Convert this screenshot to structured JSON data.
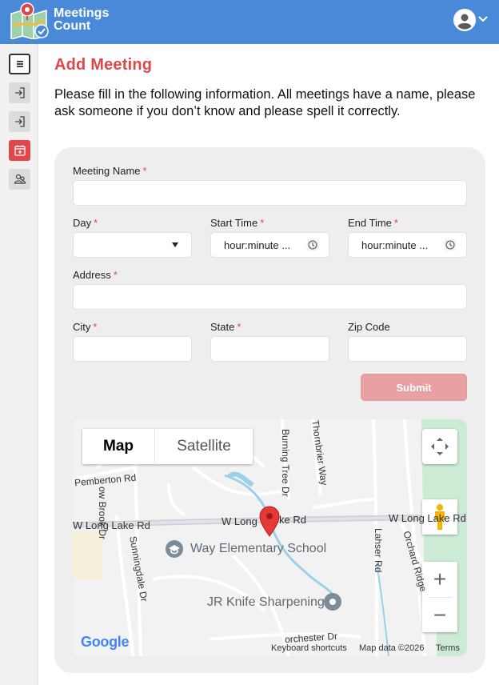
{
  "brand": {
    "line1": "Meetings",
    "line2": "Count"
  },
  "sidebar": {
    "items": [
      {
        "name": "menu"
      },
      {
        "name": "sign-in"
      },
      {
        "name": "sign-in-2"
      },
      {
        "name": "add-meeting"
      },
      {
        "name": "users"
      }
    ]
  },
  "page": {
    "title": "Add Meeting",
    "intro": "Please fill in the following information. All meetings have a name, please ask someone if you don’t know and please spell it correctly."
  },
  "form": {
    "required_mark": "*",
    "meeting_name": {
      "label": "Meeting Name",
      "value": ""
    },
    "day": {
      "label": "Day",
      "value": ""
    },
    "start_time": {
      "label": "Start Time",
      "placeholder": "hour:minute ..."
    },
    "end_time": {
      "label": "End Time",
      "placeholder": "hour:minute ..."
    },
    "address": {
      "label": "Address",
      "value": ""
    },
    "city": {
      "label": "City",
      "value": ""
    },
    "state": {
      "label": "State",
      "value": ""
    },
    "zip": {
      "label": "Zip Code",
      "value": ""
    },
    "submit_label": "Submit"
  },
  "map": {
    "type_map": "Map",
    "type_satellite": "Satellite",
    "roads": {
      "pemberton": "Pemberton Rd",
      "brook": "ow Brook Dr",
      "burning_tree": "Burning Tree Dr",
      "thornbrier": "Thornbrier Way",
      "long_lake_w": "W Long Lake Rd",
      "long_lake_mid": "W Long",
      "long_lake_mid2": "ke Rd",
      "long_lake_e": "W Long Lake Rd",
      "sunningdale": "Sunningdale Dr",
      "lahser": "Lahser Rd",
      "orchard": "Orchard Ridge",
      "dorchester": "orchester Dr"
    },
    "poi_school": "Way Elementary School",
    "poi_knife": "JR Knife Sharpening",
    "google": "Google",
    "shortcuts": "Keyboard shortcuts",
    "map_data": "Map data ©2026",
    "terms": "Terms",
    "zoom_in": "+",
    "zoom_out": "−"
  },
  "colors": {
    "header": "#4a89d8",
    "accent": "#e0474b",
    "submit_disabled": "#e8a0a3"
  }
}
